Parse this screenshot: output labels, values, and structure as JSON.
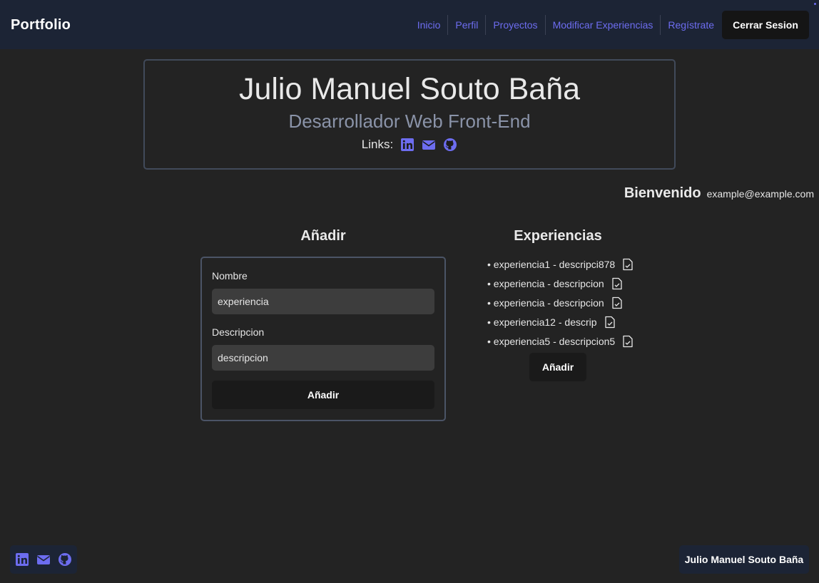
{
  "navbar": {
    "brand": "Portfolio",
    "links": [
      {
        "label": "Inicio"
      },
      {
        "label": "Perfil"
      },
      {
        "label": "Proyectos"
      },
      {
        "label": "Modificar Experiencias"
      },
      {
        "label": "Regístrate"
      }
    ],
    "logout_label": "Cerrar Sesion",
    "link_color": "#6d6df0"
  },
  "header": {
    "name": "Julio Manuel Souto Baña",
    "role": "Desarrollador Web Front-End",
    "links_label": "Links:",
    "icons": [
      "linkedin-icon",
      "mail-icon",
      "github-icon"
    ]
  },
  "welcome": {
    "title": "Bienvenido",
    "email": "example@example.com"
  },
  "add_form": {
    "title": "Añadir",
    "name_label": "Nombre",
    "name_value": "experiencia",
    "description_label": "Descripcion",
    "description_value": "descripcion",
    "submit_label": "Añadir"
  },
  "experiences": {
    "title": "Experiencias",
    "items": [
      {
        "text": "• experiencia1 - descripci878"
      },
      {
        "text": "• experiencia - descripcion"
      },
      {
        "text": "• experiencia - descripcion"
      },
      {
        "text": "• experiencia12 - descrip"
      },
      {
        "text": "• experiencia5 - descripcion5"
      }
    ],
    "item_icon": "file-edit-icon",
    "add_label": "Añadir"
  },
  "footer": {
    "icons": [
      "linkedin-icon",
      "mail-icon",
      "github-icon"
    ],
    "name": "Julio Manuel Souto Baña"
  },
  "colors": {
    "background": "#232323",
    "navbar": "#1c2435",
    "accent": "#6d6df0"
  }
}
